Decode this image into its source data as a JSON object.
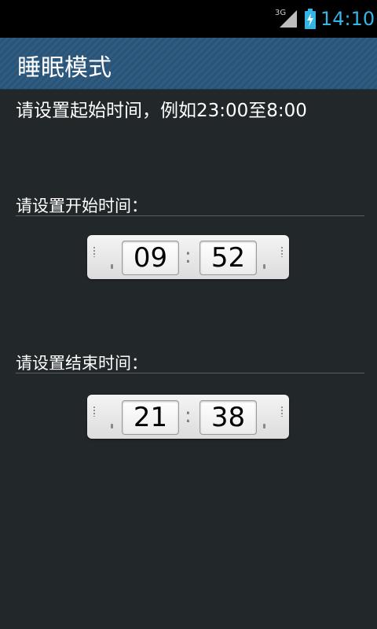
{
  "status_bar": {
    "network": "3G",
    "time": "14:10",
    "icons": [
      "signal-icon",
      "battery-charging-icon"
    ],
    "time_color": "#33b5e5"
  },
  "app": {
    "title": "睡眠模式"
  },
  "main": {
    "hint": "请设置起始时间，例如23:00至8:00",
    "start": {
      "label": "请设置开始时间：",
      "hour": "09",
      "separator": ":",
      "minute": "52"
    },
    "end": {
      "label": "请设置结束时间：",
      "hour": "21",
      "separator": ":",
      "minute": "38"
    }
  },
  "colors": {
    "background": "#22272a",
    "titlebar": "#2f5c80",
    "picker": "#e6e6e6"
  }
}
